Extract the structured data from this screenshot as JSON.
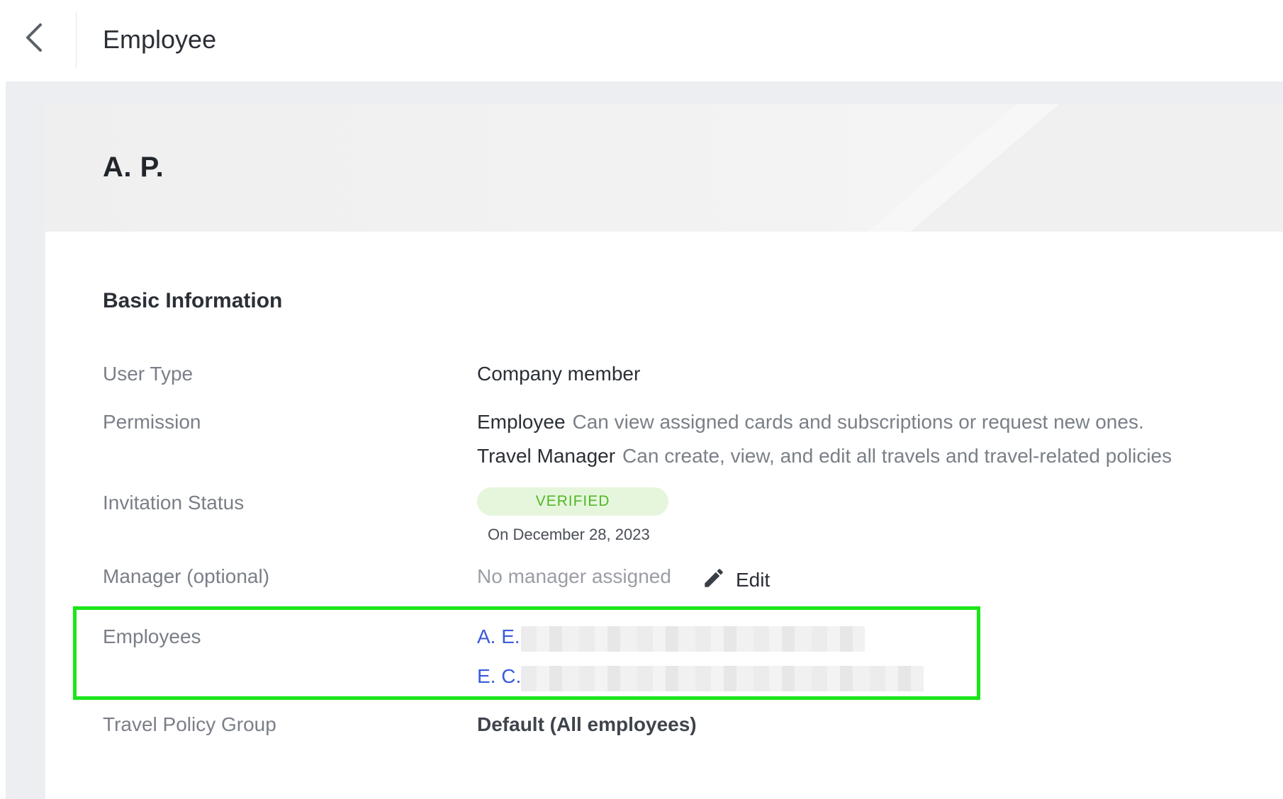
{
  "header": {
    "title": "Employee"
  },
  "profile": {
    "name": "A. P."
  },
  "basic_information": {
    "title": "Basic Information",
    "user_type": {
      "label": "User Type",
      "value": "Company member"
    },
    "permission": {
      "label": "Permission",
      "items": [
        {
          "role": "Employee",
          "description": "Can view assigned cards and subscriptions or request new ones."
        },
        {
          "role": "Travel Manager",
          "description": "Can create, view, and edit all travels and travel-related policies"
        }
      ]
    },
    "invitation_status": {
      "label": "Invitation Status",
      "badge": "VERIFIED",
      "date": "On December 28, 2023"
    },
    "manager": {
      "label": "Manager (optional)",
      "value": "No manager assigned",
      "edit_label": "Edit"
    },
    "employees": {
      "label": "Employees",
      "items": [
        "A. E.",
        "E. C."
      ]
    },
    "travel_policy_group": {
      "label": "Travel Policy Group",
      "value": "Default (All employees)"
    }
  },
  "colors": {
    "link": "#3b5bdb",
    "verified_text": "#52b82a",
    "verified_bg": "#e6f6dc",
    "highlight_border": "#19e619"
  }
}
